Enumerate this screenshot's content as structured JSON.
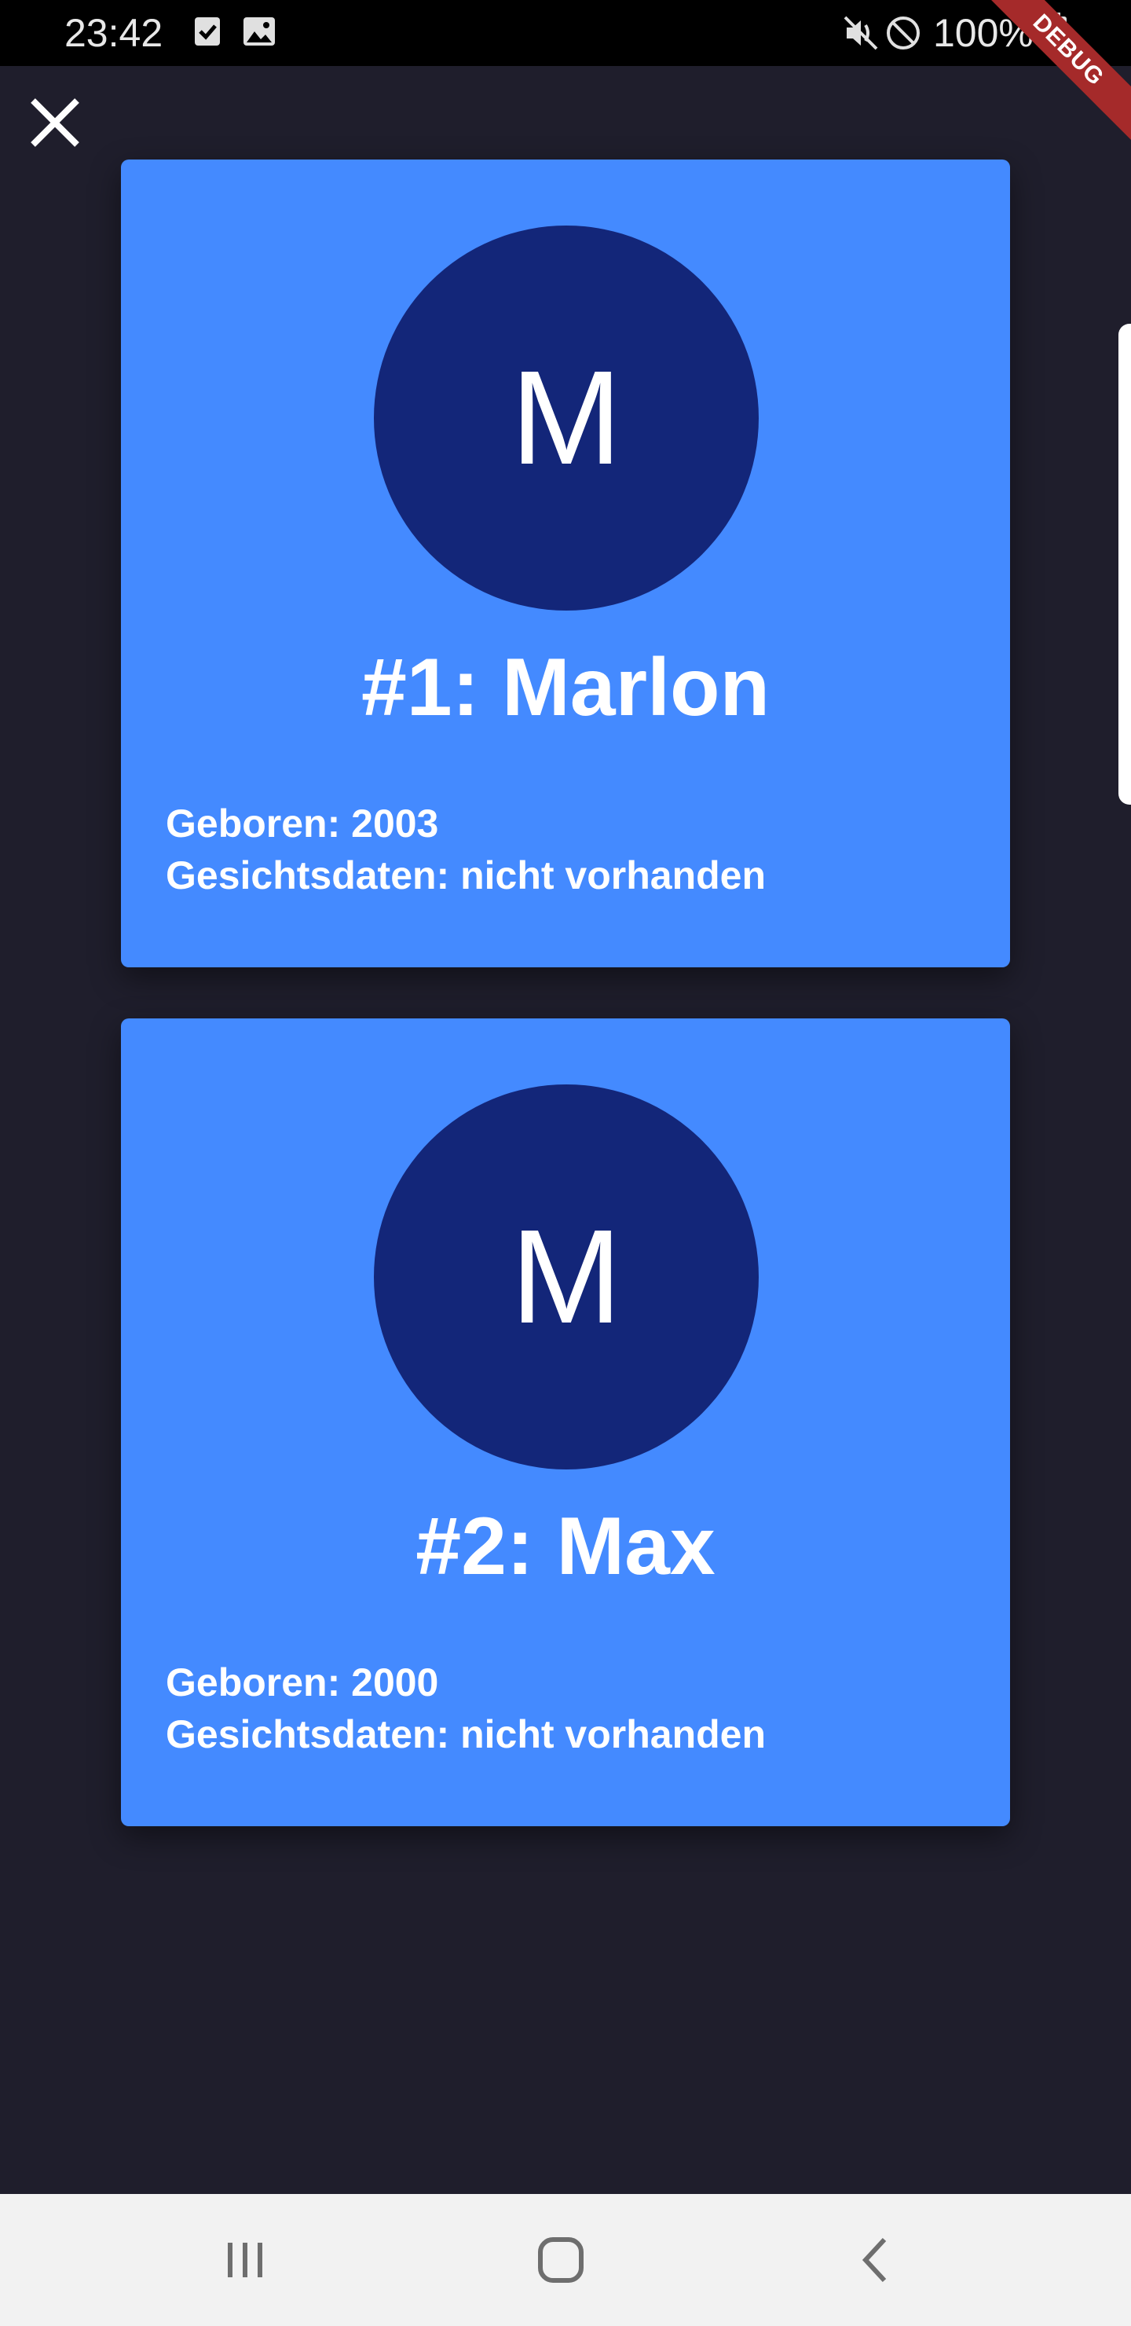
{
  "status_bar": {
    "time": "23:42",
    "battery": "100%",
    "icons": [
      "checkbox-notification-icon",
      "image-notification-icon",
      "mute-icon",
      "do-not-disturb-icon",
      "battery-icon"
    ]
  },
  "debug_banner": "DEBUG",
  "close_icon": "close-icon",
  "cards": [
    {
      "avatar_letter": "M",
      "title": "#1: Marlon",
      "born": "Geboren: 2003",
      "face_data": "Gesichtsdaten: nicht vorhanden"
    },
    {
      "avatar_letter": "M",
      "title": "#2: Max",
      "born": "Geboren: 2000",
      "face_data": "Gesichtsdaten: nicht vorhanden"
    }
  ],
  "nav_bar": {
    "buttons": [
      "recent-apps-icon",
      "home-icon",
      "back-icon"
    ]
  },
  "colors": {
    "background": "#1f1e2c",
    "card": "#448aff",
    "avatar": "#132679",
    "debug_ribbon": "#a52a2a"
  }
}
